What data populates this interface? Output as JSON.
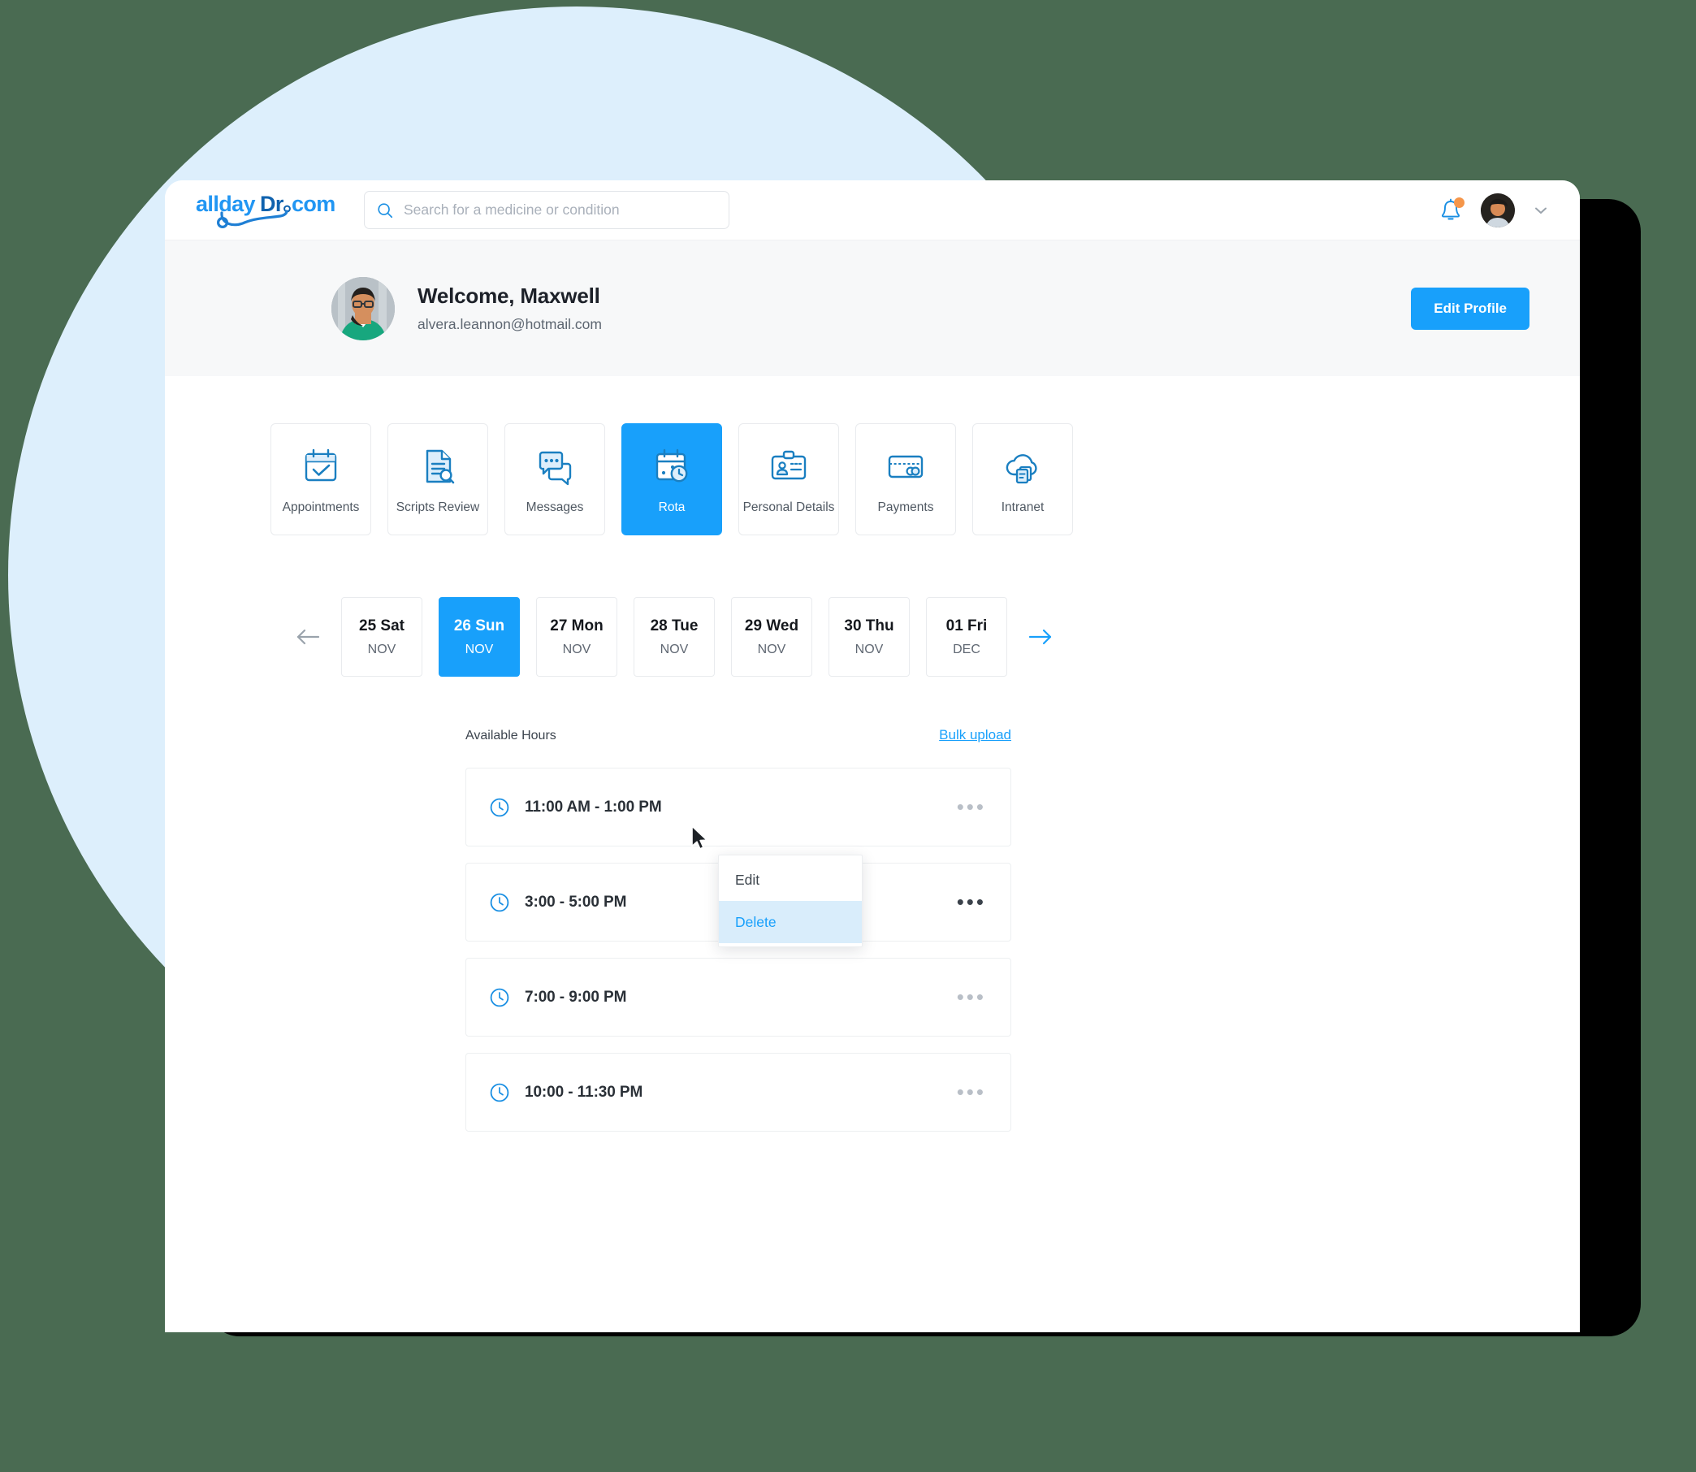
{
  "brand": {
    "logo_text": "alldayDr.com",
    "accent_color": "#18a0fb",
    "page_background": "#4a6b52",
    "decor_circle_color": "#ddeffc"
  },
  "navbar": {
    "search": {
      "placeholder": "Search for a medicine or condition",
      "value": "",
      "icon": "search-icon"
    },
    "notifications": {
      "icon": "bell-icon",
      "has_unread": true,
      "dot_color": "#f5964a"
    },
    "account": {
      "icon": "avatar",
      "chevron": "chevron-down-icon"
    }
  },
  "welcome": {
    "title": "Welcome, Maxwell",
    "email": "alvera.leannon@hotmail.com",
    "edit_button": "Edit Profile"
  },
  "tiles": [
    {
      "label": "Appointments",
      "icon": "calendar-check-icon",
      "active": false
    },
    {
      "label": "Scripts Review",
      "icon": "document-search-icon",
      "active": false
    },
    {
      "label": "Messages",
      "icon": "chat-bubbles-icon",
      "active": false
    },
    {
      "label": "Rota",
      "icon": "calendar-clock-icon",
      "active": true
    },
    {
      "label": "Personal Details",
      "icon": "id-badge-icon",
      "active": false
    },
    {
      "label": "Payments",
      "icon": "credit-card-icon",
      "active": false
    },
    {
      "label": "Intranet",
      "icon": "cloud-document-icon",
      "active": false
    }
  ],
  "date_strip": {
    "prev_icon": "arrow-left-icon",
    "next_icon": "arrow-right-icon",
    "dates": [
      {
        "day": "25 Sat",
        "month": "NOV",
        "active": false
      },
      {
        "day": "26 Sun",
        "month": "NOV",
        "active": true
      },
      {
        "day": "27 Mon",
        "month": "NOV",
        "active": false
      },
      {
        "day": "28 Tue",
        "month": "NOV",
        "active": false
      },
      {
        "day": "29 Wed",
        "month": "NOV",
        "active": false
      },
      {
        "day": "30 Thu",
        "month": "NOV",
        "active": false
      },
      {
        "day": "01 Fri",
        "month": "DEC",
        "active": false
      }
    ]
  },
  "available_hours": {
    "title": "Available Hours",
    "bulk_upload_label": "Bulk upload",
    "slots": [
      {
        "time": "11:00 AM - 1:00 PM",
        "icon": "clock-icon",
        "menu_open": false
      },
      {
        "time": "3:00 - 5:00 PM",
        "icon": "clock-icon",
        "menu_open": true
      },
      {
        "time": "7:00 - 9:00 PM",
        "icon": "clock-icon",
        "menu_open": false
      },
      {
        "time": "10:00 - 11:30 PM",
        "icon": "clock-icon",
        "menu_open": false
      }
    ],
    "menu_trigger_label": "•••",
    "context_menu": {
      "items": [
        {
          "label": "Edit",
          "highlighted": false
        },
        {
          "label": "Delete",
          "highlighted": true
        }
      ]
    }
  }
}
